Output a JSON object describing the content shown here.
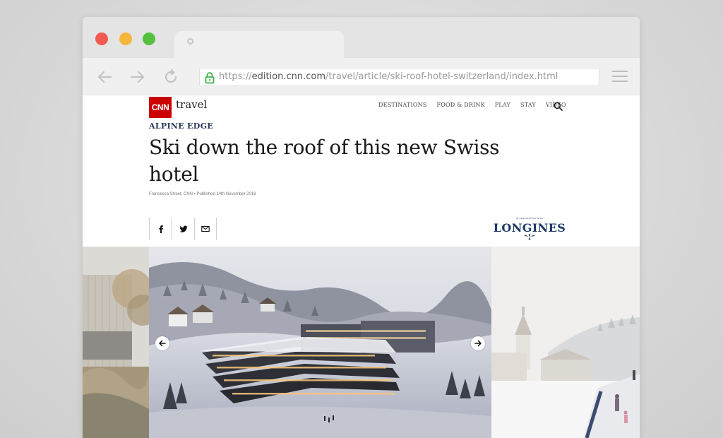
{
  "browser": {
    "url_prefix": "https://",
    "url_domain": "edition.cnn.com",
    "url_path": "/travel/article/ski-roof-hotel-switzerland/index.html",
    "icons": [
      "back-arrow-icon",
      "forward-arrow-icon",
      "reload-icon",
      "lock-icon",
      "hamburger-menu-icon"
    ],
    "colors": {
      "close": "#f25b4f",
      "minimize": "#f5b63a",
      "maximize": "#56c13e",
      "lock": "#3cb64a"
    }
  },
  "site": {
    "logo_text": "CNN",
    "section_word": "travel",
    "brand_color": "#cc0000",
    "nav": [
      "DESTINATIONS",
      "FOOD & DRINK",
      "PLAY",
      "STAY",
      "VIDEO"
    ]
  },
  "article": {
    "kicker": "ALPINE EDGE",
    "headline": "Ski down the roof of this new Swiss hotel",
    "byline": "Francesca Street, CNN • Published 14th November 2018",
    "share_icons": [
      "facebook-icon",
      "twitter-icon",
      "email-icon"
    ]
  },
  "sponsor": {
    "tagline": "IN ASSOCIATION WITH",
    "name": "LONGINES",
    "color": "#1f3a67"
  },
  "gallery": {
    "icons": [
      "arrow-left-icon",
      "arrow-right-icon"
    ]
  }
}
